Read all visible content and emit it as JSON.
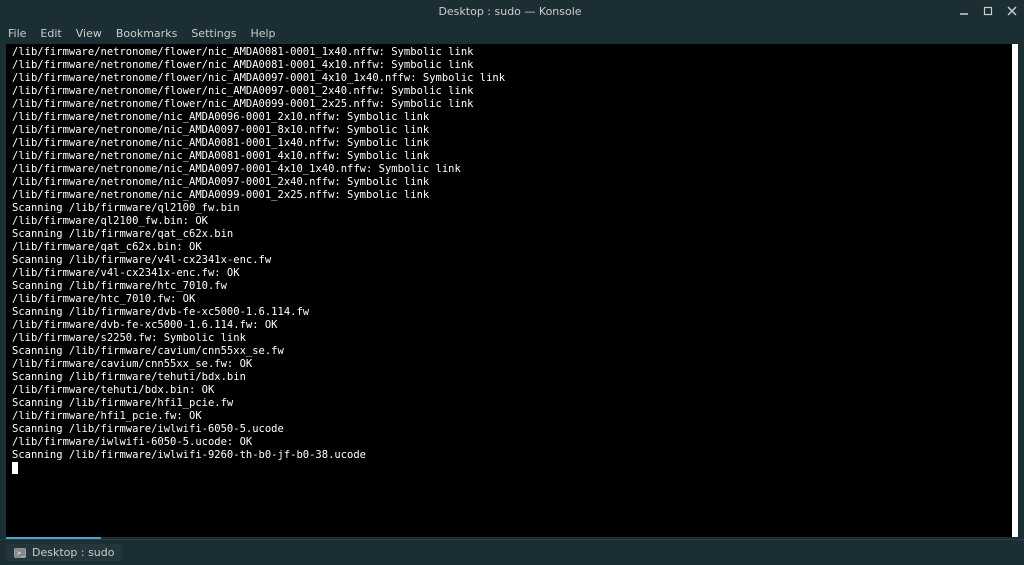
{
  "window": {
    "title": "Desktop : sudo — Konsole"
  },
  "menu": {
    "file": "File",
    "edit": "Edit",
    "view": "View",
    "bookmarks": "Bookmarks",
    "settings": "Settings",
    "help": "Help"
  },
  "taskbar": {
    "label": "Desktop : sudo"
  },
  "terminal_lines": [
    "/lib/firmware/netronome/flower/nic_AMDA0081-0001_1x40.nffw: Symbolic link",
    "/lib/firmware/netronome/flower/nic_AMDA0081-0001_4x10.nffw: Symbolic link",
    "/lib/firmware/netronome/flower/nic_AMDA0097-0001_4x10_1x40.nffw: Symbolic link",
    "/lib/firmware/netronome/flower/nic_AMDA0097-0001_2x40.nffw: Symbolic link",
    "/lib/firmware/netronome/flower/nic_AMDA0099-0001_2x25.nffw: Symbolic link",
    "/lib/firmware/netronome/nic_AMDA0096-0001_2x10.nffw: Symbolic link",
    "/lib/firmware/netronome/nic_AMDA0097-0001_8x10.nffw: Symbolic link",
    "/lib/firmware/netronome/nic_AMDA0081-0001_1x40.nffw: Symbolic link",
    "/lib/firmware/netronome/nic_AMDA0081-0001_4x10.nffw: Symbolic link",
    "/lib/firmware/netronome/nic_AMDA0097-0001_4x10_1x40.nffw: Symbolic link",
    "/lib/firmware/netronome/nic_AMDA0097-0001_2x40.nffw: Symbolic link",
    "/lib/firmware/netronome/nic_AMDA0099-0001_2x25.nffw: Symbolic link",
    "Scanning /lib/firmware/ql2100_fw.bin",
    "/lib/firmware/ql2100_fw.bin: OK",
    "Scanning /lib/firmware/qat_c62x.bin",
    "/lib/firmware/qat_c62x.bin: OK",
    "Scanning /lib/firmware/v4l-cx2341x-enc.fw",
    "/lib/firmware/v4l-cx2341x-enc.fw: OK",
    "Scanning /lib/firmware/htc_7010.fw",
    "/lib/firmware/htc_7010.fw: OK",
    "Scanning /lib/firmware/dvb-fe-xc5000-1.6.114.fw",
    "/lib/firmware/dvb-fe-xc5000-1.6.114.fw: OK",
    "/lib/firmware/s2250.fw: Symbolic link",
    "Scanning /lib/firmware/cavium/cnn55xx_se.fw",
    "/lib/firmware/cavium/cnn55xx_se.fw: OK",
    "Scanning /lib/firmware/tehuti/bdx.bin",
    "/lib/firmware/tehuti/bdx.bin: OK",
    "Scanning /lib/firmware/hfi1_pcie.fw",
    "/lib/firmware/hfi1_pcie.fw: OK",
    "Scanning /lib/firmware/iwlwifi-6050-5.ucode",
    "/lib/firmware/iwlwifi-6050-5.ucode: OK",
    "Scanning /lib/firmware/iwlwifi-9260-th-b0-jf-b0-38.ucode"
  ]
}
